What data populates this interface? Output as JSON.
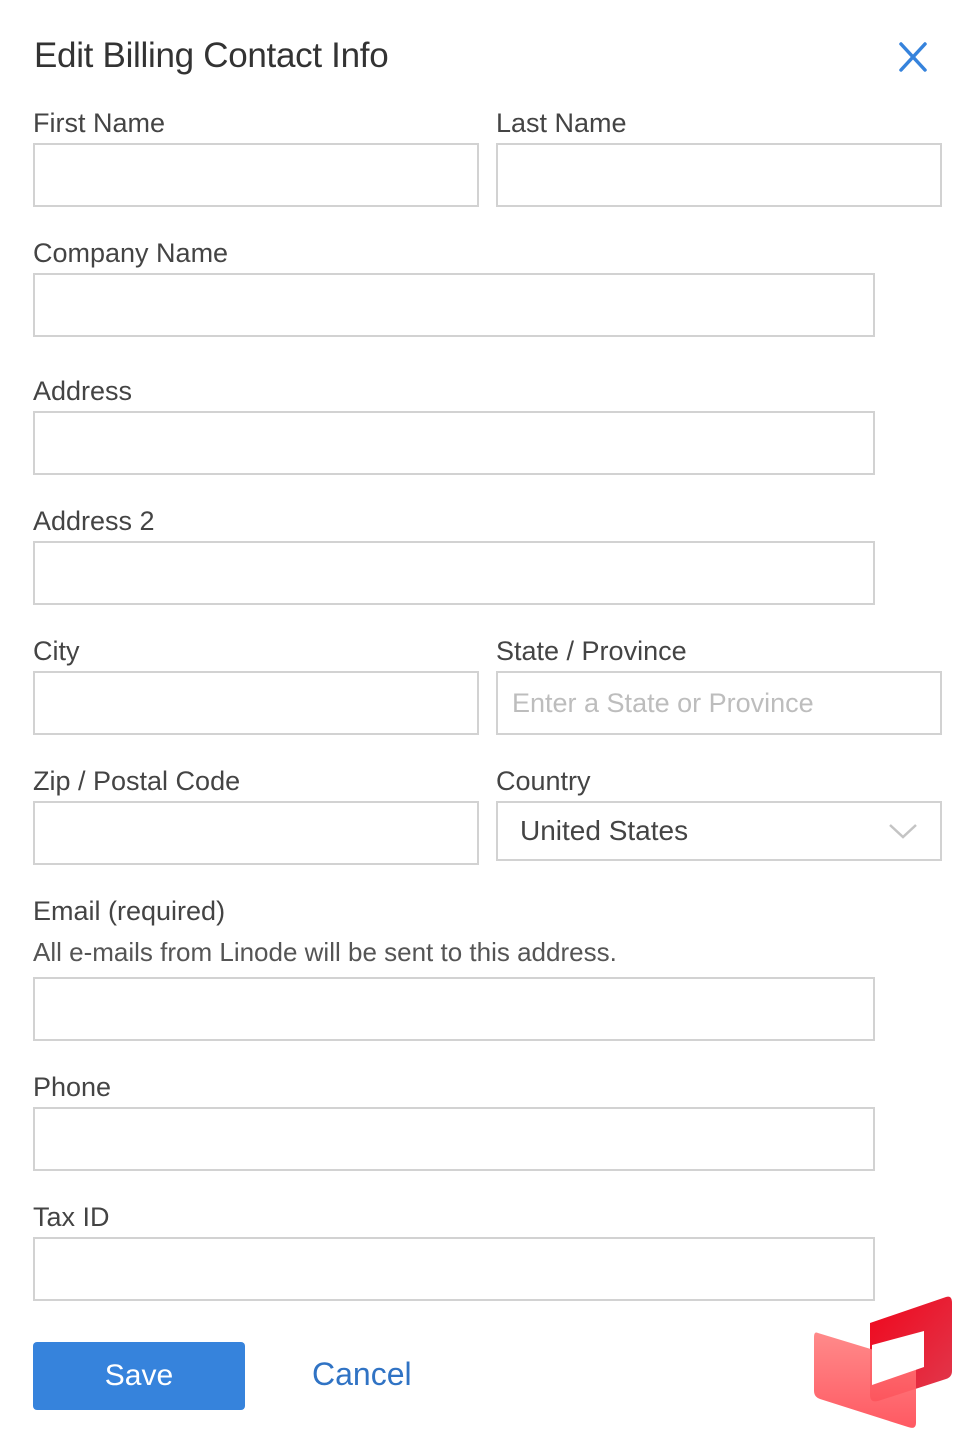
{
  "dialog": {
    "title": "Edit Billing Contact Info",
    "close_icon": "close-x-icon"
  },
  "fields": {
    "first_name": {
      "label": "First Name",
      "value": "",
      "placeholder": ""
    },
    "last_name": {
      "label": "Last Name",
      "value": "",
      "placeholder": ""
    },
    "company_name": {
      "label": "Company Name",
      "value": "",
      "placeholder": ""
    },
    "address": {
      "label": "Address",
      "value": "",
      "placeholder": ""
    },
    "address2": {
      "label": "Address 2",
      "value": "",
      "placeholder": ""
    },
    "city": {
      "label": "City",
      "value": "",
      "placeholder": ""
    },
    "state": {
      "label": "State / Province",
      "value": "",
      "placeholder": "Enter a State or Province"
    },
    "zip": {
      "label": "Zip / Postal Code",
      "value": "",
      "placeholder": ""
    },
    "country": {
      "label": "Country",
      "selected": "United States"
    },
    "email": {
      "label": "Email (required)",
      "helper": "All e-mails from Linode will be sent to this address.",
      "value": "",
      "placeholder": ""
    },
    "phone": {
      "label": "Phone",
      "value": "",
      "placeholder": ""
    },
    "tax_id": {
      "label": "Tax ID",
      "value": "",
      "placeholder": ""
    }
  },
  "actions": {
    "save_label": "Save",
    "cancel_label": "Cancel"
  },
  "colors": {
    "primary": "#3683dc",
    "link": "#3073c4",
    "border": "#d2d2d2",
    "logo_red": "#e8102a"
  }
}
